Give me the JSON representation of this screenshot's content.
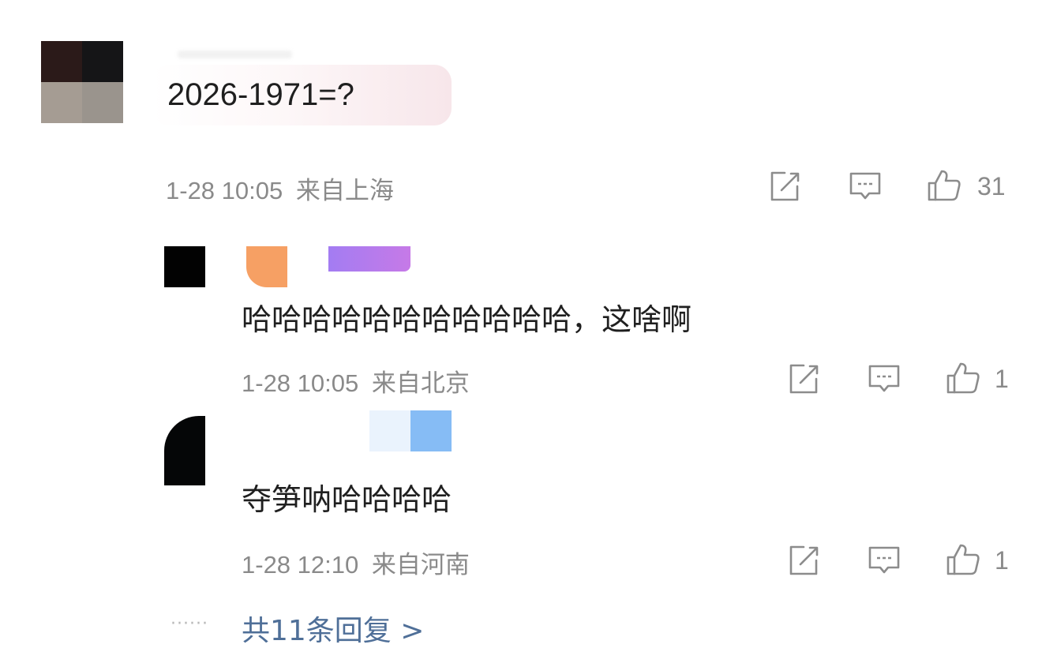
{
  "main_comment": {
    "text": "2026-1971=?",
    "time": "1-28 10:05",
    "location": "来自上海",
    "like_count": "31"
  },
  "replies": [
    {
      "text": "哈哈哈哈哈哈哈哈哈哈哈，这啥啊",
      "time": "1-28 10:05",
      "location": "来自北京",
      "like_count": "1"
    },
    {
      "text": "夺笋呐哈哈哈哈",
      "time": "1-28 12:10",
      "location": "来自河南",
      "like_count": "1"
    }
  ],
  "more_replies": {
    "dots": "······",
    "label": "共11条回复 >"
  },
  "icons": {
    "forward": "share-square-icon",
    "comment": "comment-bubble-icon",
    "like": "thumbs-up-icon"
  }
}
